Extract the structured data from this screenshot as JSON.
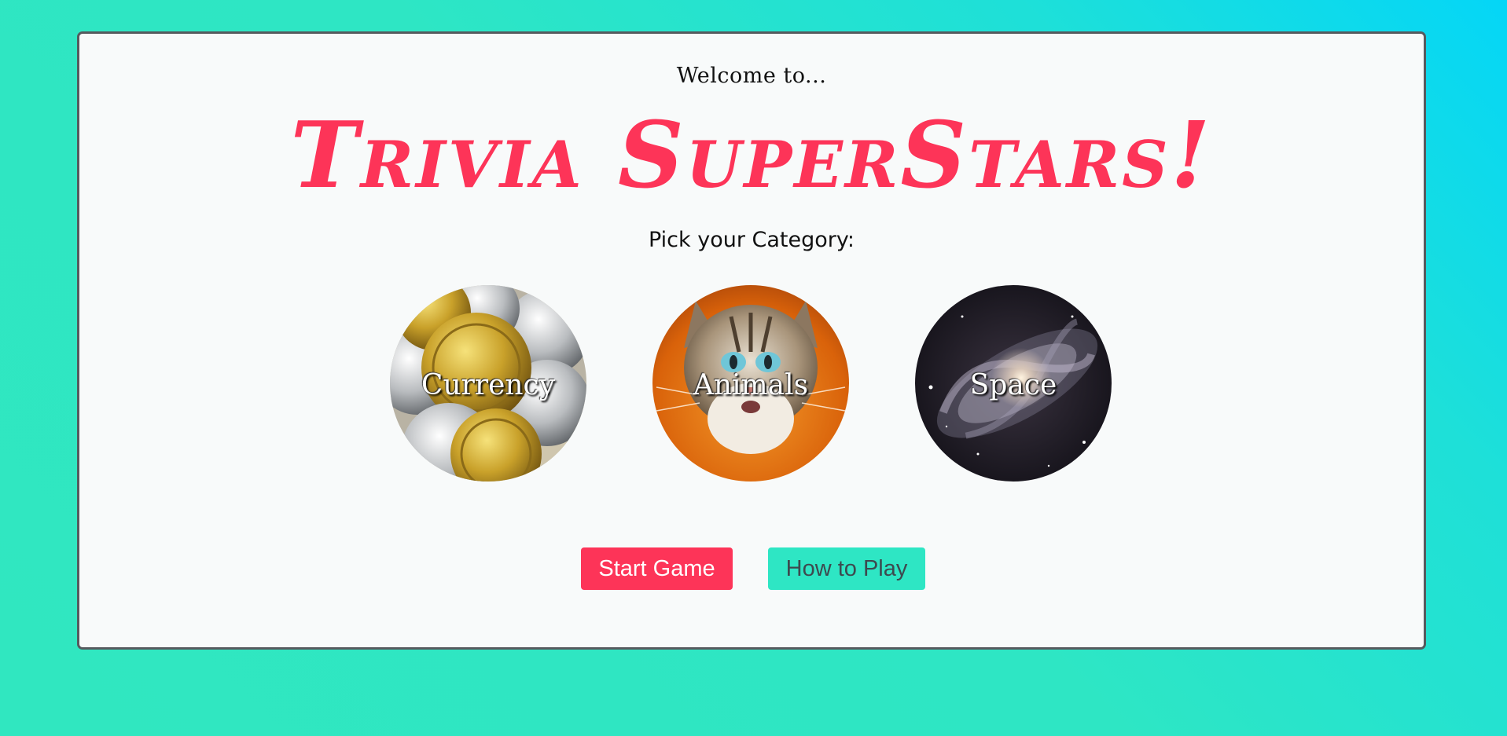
{
  "welcome_text": "Welcome to...",
  "title": "Trivia SuperStars!",
  "pick_prompt": "Pick your Category:",
  "categories": [
    {
      "label": "Currency",
      "image": "gold-silver-coins"
    },
    {
      "label": "Animals",
      "image": "cat-looking-up"
    },
    {
      "label": "Space",
      "image": "spiral-galaxy"
    }
  ],
  "buttons": {
    "start": "Start Game",
    "how_to_play": "How to Play"
  },
  "colors": {
    "accent": "#fd3458",
    "teal": "#2ee6c4",
    "background_gradient_start": "#04d6f7",
    "background_gradient_end": "#30e7c0",
    "card": "#f8fafa"
  }
}
